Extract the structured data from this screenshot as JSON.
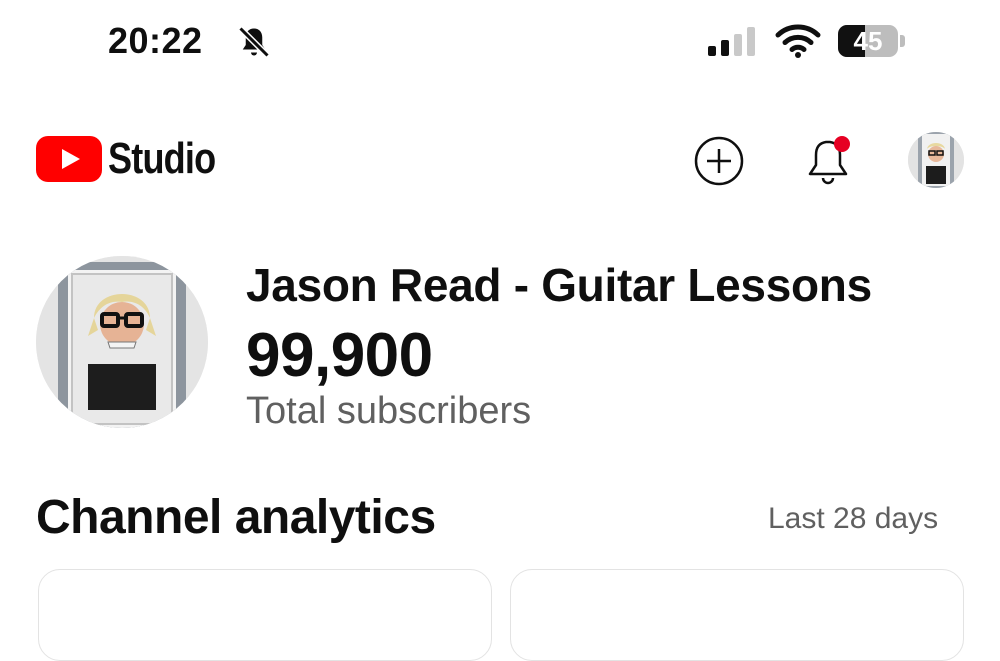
{
  "status_bar": {
    "time": "20:22",
    "battery_percent": "45",
    "battery_level": 0.45,
    "signal_bars_active": 2,
    "signal_bars_total": 4
  },
  "header": {
    "brand": "Studio",
    "brand_color": "#ff0000",
    "notification_dot_color": "#e60023",
    "icons": [
      "youtube-logo",
      "create-plus-icon",
      "notification-bell-icon",
      "account-avatar"
    ]
  },
  "channel": {
    "name": "Jason Read - Guitar Lessons",
    "subscriber_count": "99,900",
    "subscriber_label": "Total subscribers"
  },
  "analytics": {
    "title": "Channel analytics",
    "period": "Last 28 days"
  },
  "colors": {
    "text_primary": "#0f0f0f",
    "text_secondary": "#606060"
  }
}
